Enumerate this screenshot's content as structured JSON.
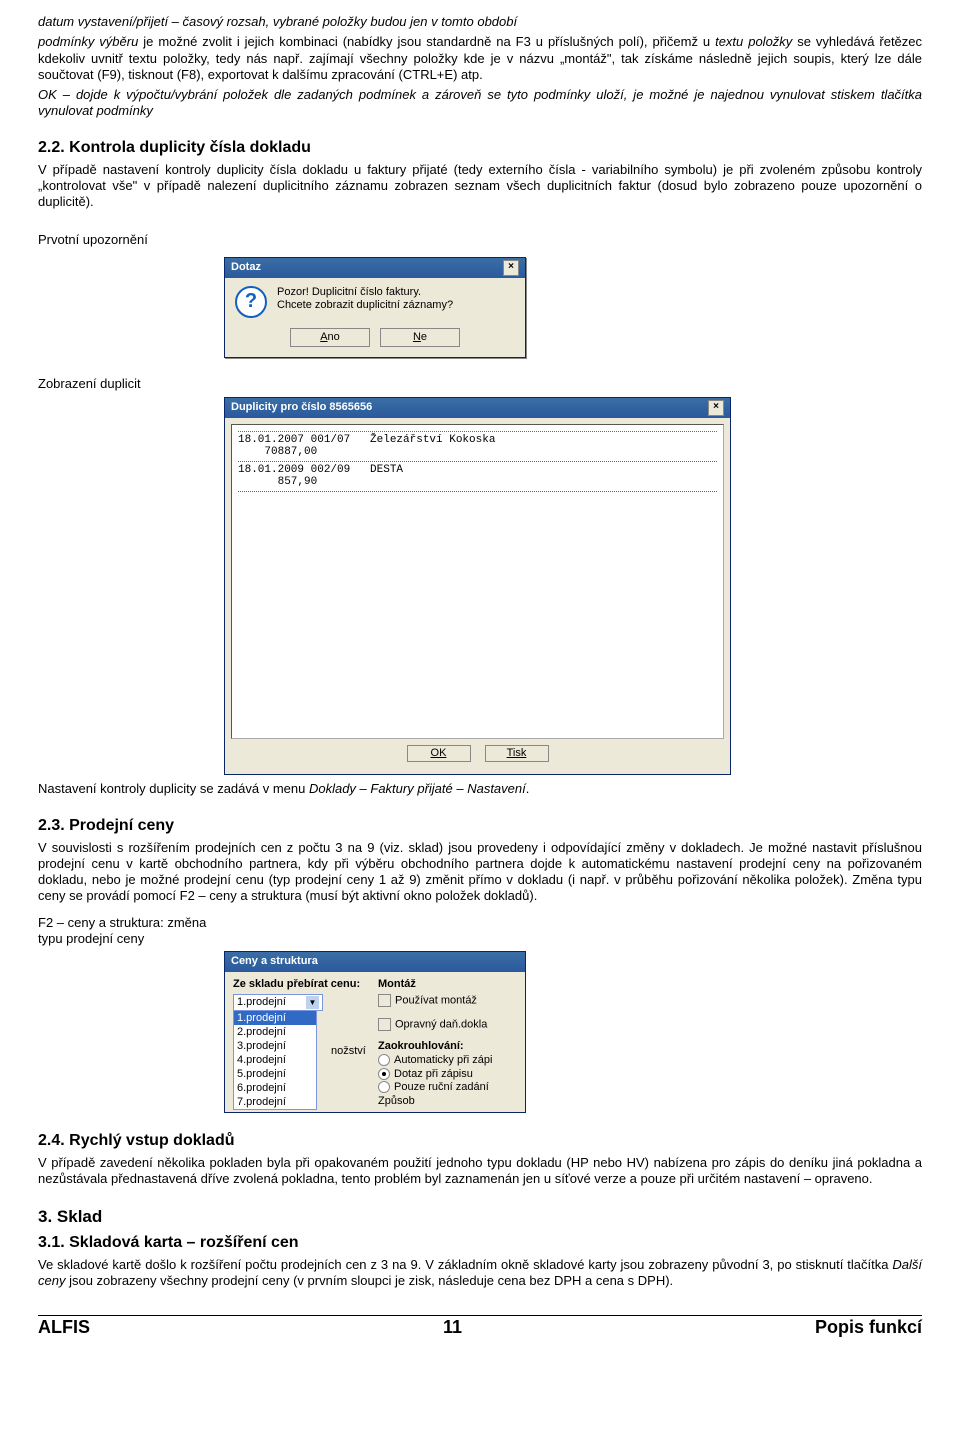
{
  "top": {
    "l1": "datum vystavení/přijetí – časový rozsah, vybrané položky budou jen v tomto období",
    "l2a": "podmínky výběru",
    "l2b": " je možné zvolit i jejich kombinaci (nabídky jsou standardně na F3 u příslušných polí), přičemž u ",
    "l2c": "textu položky",
    "l2d": " se vyhledává řetězec kdekoliv uvnitř textu položky, tedy nás např. zajímají všechny položky kde je v názvu „montáž\", tak získáme následně jejich soupis, který lze dále součtovat (F9), tisknout (F8), exportovat k dalšímu zpracování (CTRL+E) atp.",
    "l3a": "OK – dojde k výpočtu/vybrání položek dle zadaných podmínek a zároveň se tyto podmínky uloží, je možné je najednou vynulovat stiskem tlačítka ",
    "l3b": "vynulovat podmínky"
  },
  "s22": {
    "h": "2.2.  Kontrola duplicity čísla dokladu",
    "p": "V případě nastavení kontroly duplicity čísla dokladu u faktury přijaté (tedy externího čísla - variabilního symbolu) je při zvoleném způsobu kontroly „kontrolovat vše\" v případě nalezení duplicitního záznamu zobrazen seznam všech duplicitních faktur (dosud bylo zobrazeno pouze upozornění o duplicitě).",
    "lbl1": "Prvotní upozornění",
    "lbl2": "Zobrazení duplicit",
    "settings": "Nastavení kontroly duplicity se zadává v menu Doklady – Faktury přijaté – Nastavení."
  },
  "dlg1": {
    "title": "Dotaz",
    "line1": "Pozor! Duplicitní číslo faktury.",
    "line2": "Chcete zobrazit duplicitní záznamy?",
    "yes": "Ano",
    "no": "Ne"
  },
  "dlg2": {
    "title": "Duplicity pro číslo 8565656",
    "row1a": "18.01.2007 001/07   Železářství Kokoska",
    "row1b": "    70887,00",
    "row2a": "18.01.2009 002/09   DESTA",
    "row2b": "      857,90",
    "ok": "OK",
    "tisk": "Tisk"
  },
  "s23": {
    "h": "2.3.  Prodejní ceny",
    "p": "V souvislosti s rozšířením prodejních cen z počtu 3 na 9 (viz. sklad) jsou provedeny i odpovídající změny v dokladech. Je možné nastavit příslušnou prodejní cenu v kartě obchodního partnera, kdy při výběru obchodního partnera dojde k automatickému nastavení prodejní ceny na pořizovaném dokladu, nebo je možné prodejní cenu (typ prodejní ceny 1 až 9) změnit přímo v dokladu (i např. v průběhu pořizování několika položek). Změna typu ceny se provádí pomocí F2 – ceny a struktura (musí být aktivní okno položek dokladů).",
    "lbl": "F2 – ceny a struktura: změna typu prodejní ceny"
  },
  "dlg3": {
    "title": "Ceny a struktura",
    "lab1": "Ze skladu přebírat cenu:",
    "sel": "1.prodejní",
    "opts": [
      "1.prodejní",
      "2.prodejní",
      "3.prodejní",
      "4.prodejní",
      "5.prodejní",
      "6.prodejní",
      "7.prodejní"
    ],
    "montazLab": "Montáž",
    "chkMontaz": "Používat montáž",
    "labMn": "nožství",
    "chkOprav": "Opravný daň.dokla",
    "labZaok": "Zaokrouhlování:",
    "rad1": "Automaticky při zápi",
    "rad2": "Dotaz při zápisu",
    "rad3": "Pouze ruční zadání",
    "labZpusob": "Způsob"
  },
  "s24": {
    "h": "2.4.  Rychlý vstup dokladů",
    "p": "V případě zavedení několika pokladen byla při opakovaném použití jednoho typu dokladu (HP nebo HV) nabízena pro zápis do deníku jiná pokladna a nezůstávala přednastavená dříve zvolená pokladna, tento problém byl zaznamenán jen u síťové verze a pouze při určitém nastavení – opraveno."
  },
  "s3": {
    "h": "3.   Sklad"
  },
  "s31": {
    "h": "3.1.  Skladová karta – rozšíření cen",
    "p": "Ve skladové kartě došlo k rozšíření počtu prodejních cen z 3 na 9. V základním okně skladové karty jsou zobrazeny původní 3, po stisknutí tlačítka Další ceny jsou zobrazeny všechny prodejní ceny (v prvním sloupci je zisk, následuje cena bez DPH a cena s DPH)."
  },
  "footer": {
    "l": "ALFIS",
    "c": "11",
    "r": "Popis funkcí"
  }
}
